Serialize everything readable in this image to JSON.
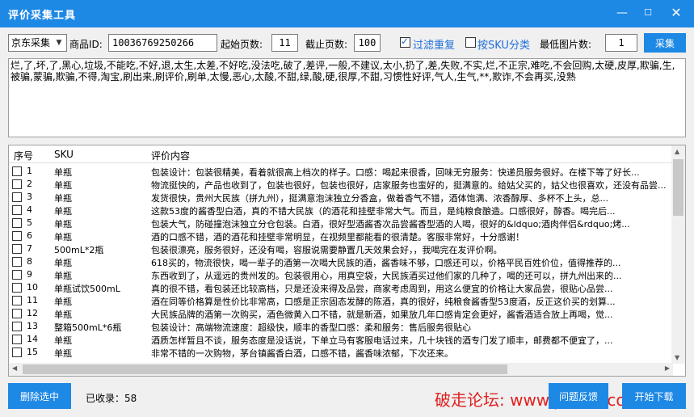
{
  "window": {
    "title": "评价采集工具",
    "minimize_symbol": "—",
    "maximize_symbol": "☐",
    "close_symbol": "✕"
  },
  "toolbar": {
    "source_select": "京东采集",
    "product_id_label": "商品ID:",
    "product_id_value": "10036769250266",
    "start_page_label": "起始页数:",
    "start_page_value": "11",
    "end_page_label": "截止页数:",
    "end_page_value": "100",
    "filter_dup_label": "过滤重复",
    "filter_dup_checked": true,
    "by_sku_label": "按SKU分类",
    "by_sku_checked": false,
    "min_images_label": "最低图片数:",
    "min_images_value": "1",
    "collect_button": "采集"
  },
  "filter_words": "烂,了,坏,了,黑心,垃圾,不能吃,不好,退,太生,太差,不好吃,没法吃,破了,差评,一般,不建议,太小,扔了,差,失败,不实,烂,不正宗,难吃,不会回购,太硬,皮厚,欺骗,生,被骗,蒙骗,欺骗,不得,淘宝,刷出来,刷评价,刷单,太慢,恶心,太酸,不甜,绿,酸,硬,很厚,不甜,习惯性好评,气人,生气,**,欺诈,不会再买,没熟",
  "table": {
    "headers": {
      "index": "序号",
      "sku": "SKU",
      "comment": "评价内容"
    },
    "rows": [
      {
        "index": "1",
        "sku": "单瓶",
        "comment": "包装设计：包装很精美，看着就很高上档次的样子。口感：喝起来很香，回味无穷服务：快递员服务很好。在楼下等了好长..."
      },
      {
        "index": "2",
        "sku": "单瓶",
        "comment": "物流挺快的，产品也收到了，包装也很好，包装也很好，店家服务也蛮好的，挺满意的。给姑父买的，姑父也很喜欢，还没有品尝..."
      },
      {
        "index": "3",
        "sku": "单瓶",
        "comment": "发货很快，贵州大民族（拼九州），挺满意泡沫独立分香盒，做着香气不错，酒体饱满、浓香醇厚、多杯不上头，总..."
      },
      {
        "index": "4",
        "sku": "单瓶",
        "comment": "这款53度的酱香型白酒，真的不错大民族（的酒花和挂壁非常大气。而且，是纯粮食酿造。口感很好，醇香。喝完后..."
      },
      {
        "index": "5",
        "sku": "单瓶",
        "comment": "包装大气，防碰撞泡沫独立分仓包装。白酒，很好型酒酱香次品尝酱香型酒的人喝，很好的&ldquo;酒肉伴侣&rdquo;烤..."
      },
      {
        "index": "6",
        "sku": "单瓶",
        "comment": "酒的口感不错，酒的酒花和挂壁非常明显，在视频里都能看的很清楚。客服非常好，十分感谢！"
      },
      {
        "index": "7",
        "sku": "500mL*2瓶",
        "comment": "包装很漂亮，服务很好，还没有喝，容服说需要静置几天效果会好，，我喝完在发评价啊。"
      },
      {
        "index": "8",
        "sku": "单瓶",
        "comment": "618买的，物流很快，喝一辈子的酒第一次喝大民族的酒，酱香味不够，口感还可以，价格平民百姓价位，值得推荐的..."
      },
      {
        "index": "9",
        "sku": "单瓶",
        "comment": "东西收到了，从遥远的贵州发的。包装很用心，用真空袋，大民族酒买过他们家的几种了，喝的还可以，拼九州出来的..."
      },
      {
        "index": "10",
        "sku": "单瓶试饮500mL",
        "comment": "真的很不错，看包装还比较高档，只是还没来得及品尝，商家考虑周到，用这么便宜的价格让大家品尝，很贴心品尝..."
      },
      {
        "index": "11",
        "sku": "单瓶",
        "comment": "酒在同等价格算是性价比非常高，口感是正宗固态发酵的陈酒，真的很好，纯粮食酱香型53度酒，反正这价买的划算..."
      },
      {
        "index": "12",
        "sku": "单瓶",
        "comment": "大民族品牌的酒第一次购买，酒色微黄入口不错，就是新酒，如果放几年口感肯定会更好，酱香酒适合放上再喝，觉..."
      },
      {
        "index": "13",
        "sku": "整箱500mL*6瓶",
        "comment": "包装设计：高端物流速度：超级快，顺丰的香型口感：柔和服务：售后服务很贴心"
      },
      {
        "index": "14",
        "sku": "单瓶",
        "comment": "酒质怎样暂且不谈，服务态度是没话说，下单立马有客服电话过来，几十块钱的酒专门发了顺丰，邮费都不便宜了，..."
      },
      {
        "index": "15",
        "sku": "单瓶",
        "comment": "非常不错的一次购物，茅台镇酱香白酒，口感不错，酱香味浓郁，下次还来。"
      }
    ]
  },
  "footer": {
    "delete_selected": "删除选中",
    "count_label": "已收录：",
    "count_value": "58",
    "feedback_button": "问题反馈",
    "download_button": "开始下载"
  },
  "watermark": "破走论坛: www.pozou.com",
  "colors": {
    "accent": "#1e88e5",
    "watermark": "#e02020"
  }
}
